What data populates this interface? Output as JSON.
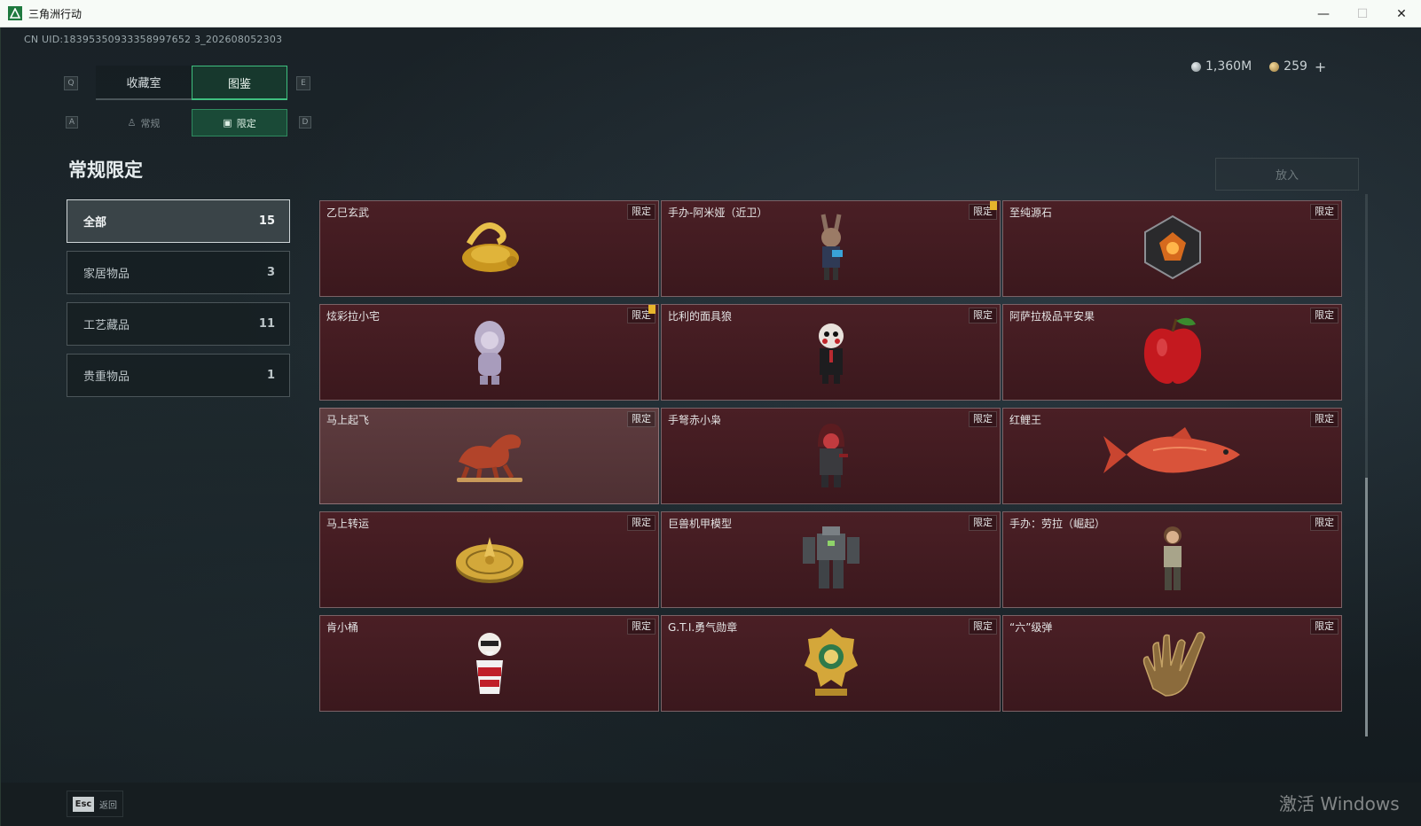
{
  "window": {
    "title": "三角洲行动",
    "minimize": "—",
    "maximize": "☐",
    "close": "✕"
  },
  "uid": "CN UID:18395350933358997652 3_202608052303",
  "currency": {
    "silver": "1,360M",
    "gold": "259",
    "plus": "+"
  },
  "key_hints": {
    "prev_tab": "Q",
    "next_tab": "E",
    "prev_sub": "A",
    "next_sub": "D"
  },
  "tabs": [
    {
      "label": "收藏室",
      "active": false
    },
    {
      "label": "图鉴",
      "active": true
    }
  ],
  "subtabs": [
    {
      "label": "常规",
      "icon": "figure-icon",
      "active": false
    },
    {
      "label": "限定",
      "icon": "image-icon",
      "active": true
    }
  ],
  "section_title": "常规限定",
  "put_button": "放入",
  "filters": [
    {
      "label": "全部",
      "count": "15",
      "active": true
    },
    {
      "label": "家居物品",
      "count": "3",
      "active": false
    },
    {
      "label": "工艺藏品",
      "count": "11",
      "active": false
    },
    {
      "label": "贵重物品",
      "count": "1",
      "active": false
    }
  ],
  "items": [
    {
      "name": "乙巳玄武",
      "tag": "限定",
      "art": "golden-snake-turtle",
      "new": false
    },
    {
      "name": "手办-阿米娅（近卫）",
      "tag": "限定",
      "art": "amiya-figure",
      "new": true
    },
    {
      "name": "至纯源石",
      "tag": "限定",
      "art": "originium-crystal",
      "new": false
    },
    {
      "name": "炫彩拉小宅",
      "tag": "限定",
      "art": "hooded-doll",
      "new": true
    },
    {
      "name": "比利的面具狼",
      "tag": "限定",
      "art": "billy-puppet",
      "new": false
    },
    {
      "name": "阿萨拉极品平安果",
      "tag": "限定",
      "art": "red-apple",
      "new": false
    },
    {
      "name": "马上起飞",
      "tag": "限定",
      "art": "red-horse",
      "new": false,
      "hover": true
    },
    {
      "name": "手弩赤小枭",
      "tag": "限定",
      "art": "hooded-soldier",
      "new": false
    },
    {
      "name": "红鲤王",
      "tag": "限定",
      "art": "red-carp",
      "new": false
    },
    {
      "name": "马上转运",
      "tag": "限定",
      "art": "golden-disc",
      "new": false
    },
    {
      "name": "巨兽机甲模型",
      "tag": "限定",
      "art": "mech-model",
      "new": false
    },
    {
      "name": "手办：劳拉（崛起）",
      "tag": "限定",
      "art": "lara-figure",
      "new": false
    },
    {
      "name": "肯小桶",
      "tag": "限定",
      "art": "colonel-bucket",
      "new": false
    },
    {
      "name": "G.T.I.勇气勋章",
      "tag": "限定",
      "art": "courage-medal",
      "new": false
    },
    {
      "name": "“六”级弹",
      "tag": "限定",
      "art": "golden-hand",
      "new": false
    }
  ],
  "bottom": {
    "esc_key": "Esc",
    "esc_label": "返回",
    "watermark": "激活 Windows"
  },
  "colors": {
    "card_bg": "#4a1f25",
    "accent_green": "#3fbf7f",
    "new_marker": "#e7b52c"
  }
}
